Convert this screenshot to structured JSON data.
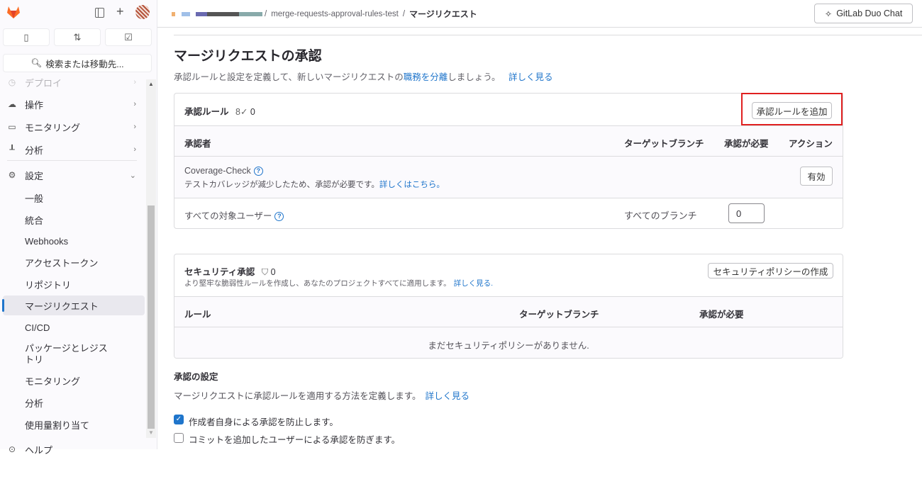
{
  "sidebar": {
    "search_placeholder": "検索または移動先...",
    "items": [
      {
        "label": "デプロイ",
        "icon": "rocket-icon"
      },
      {
        "label": "操作",
        "icon": "cloud-icon"
      },
      {
        "label": "モニタリング",
        "icon": "monitor-icon"
      },
      {
        "label": "分析",
        "icon": "chart-icon"
      },
      {
        "label": "設定",
        "icon": "gear-icon"
      }
    ],
    "sub_items": [
      "一般",
      "統合",
      "Webhooks",
      "アクセストークン",
      "リポジトリ",
      "マージリクエスト",
      "CI/CD",
      "パッケージとレジストリ",
      "モニタリング",
      "分析",
      "使用量割り当て"
    ],
    "help": "ヘルプ"
  },
  "breadcrumb": {
    "project": "merge-requests-approval-rules-test",
    "current": "マージリクエスト",
    "sep": "/"
  },
  "header": {
    "duo_chat": "GitLab Duo Chat"
  },
  "page": {
    "title": "マージリクエストの承認",
    "desc_pre": "承認ルールと設定を定義して、新しいマージリクエストの",
    "desc_link": "職務を分離",
    "desc_post": "しましょう。",
    "learn_more": "詳しく見る"
  },
  "rules": {
    "title": "承認ルール",
    "count": "0",
    "add_button": "承認ルールを追加",
    "columns": [
      "承認者",
      "ターゲットブランチ",
      "承認が必要",
      "アクション"
    ],
    "rows": [
      {
        "name": "Coverage-Check",
        "desc": "テストカバレッジが減少したため、承認が必要です。",
        "link": "詳しくはこちら。",
        "action": "有効"
      },
      {
        "name": "すべての対象ユーザー",
        "branch": "すべてのブランチ",
        "required": "0"
      }
    ]
  },
  "security": {
    "title": "セキュリティ承認",
    "count": "0",
    "desc": "より堅牢な脆弱性ルールを作成し、あなたのプロジェクトすべてに適用します。",
    "link": "詳しく見る.",
    "button": "セキュリティポリシーの作成",
    "columns": [
      "ルール",
      "ターゲットブランチ",
      "承認が必要"
    ],
    "empty": "まだセキュリティポリシーがありません."
  },
  "settings": {
    "title": "承認の設定",
    "desc": "マージリクエストに承認ルールを適用する方法を定義します。",
    "link": "詳しく見る",
    "checkboxes": [
      {
        "label": "作成者自身による承認を防止します。",
        "checked": true
      },
      {
        "label": "コミットを追加したユーザーによる承認を防ぎます。",
        "checked": false
      }
    ]
  }
}
